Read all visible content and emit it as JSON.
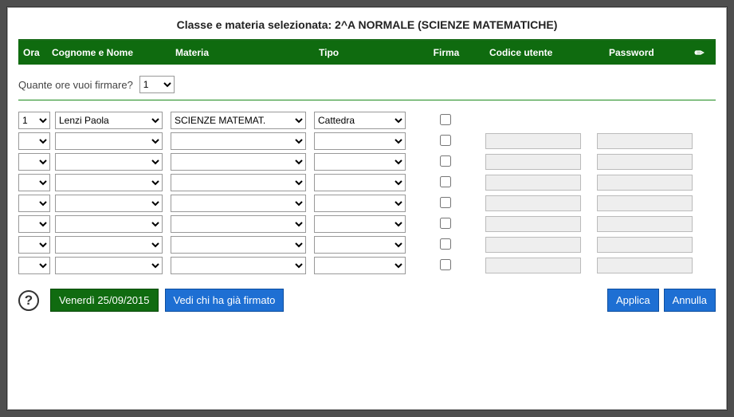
{
  "title": "Classe e materia selezionata: 2^A NORMALE (SCIENZE MATEMATICHE)",
  "columns": {
    "ora": "Ora",
    "nome": "Cognome e Nome",
    "materia": "Materia",
    "tipo": "Tipo",
    "firma": "Firma",
    "codice": "Codice utente",
    "password": "Password"
  },
  "hours_label": "Quante ore vuoi firmare?",
  "hours_value": "1",
  "rows": [
    {
      "ora": "1",
      "nome": "Lenzi Paola",
      "materia": "SCIENZE MATEMAT.",
      "tipo": "Cattedra",
      "show_inputs": false
    },
    {
      "ora": "",
      "nome": "",
      "materia": "",
      "tipo": "",
      "show_inputs": true
    },
    {
      "ora": "",
      "nome": "",
      "materia": "",
      "tipo": "",
      "show_inputs": true
    },
    {
      "ora": "",
      "nome": "",
      "materia": "",
      "tipo": "",
      "show_inputs": true
    },
    {
      "ora": "",
      "nome": "",
      "materia": "",
      "tipo": "",
      "show_inputs": true
    },
    {
      "ora": "",
      "nome": "",
      "materia": "",
      "tipo": "",
      "show_inputs": true
    },
    {
      "ora": "",
      "nome": "",
      "materia": "",
      "tipo": "",
      "show_inputs": true
    },
    {
      "ora": "",
      "nome": "",
      "materia": "",
      "tipo": "",
      "show_inputs": true
    }
  ],
  "footer": {
    "date": "Venerdì 25/09/2015",
    "vedi": "Vedi chi ha già firmato",
    "applica": "Applica",
    "annulla": "Annulla"
  }
}
